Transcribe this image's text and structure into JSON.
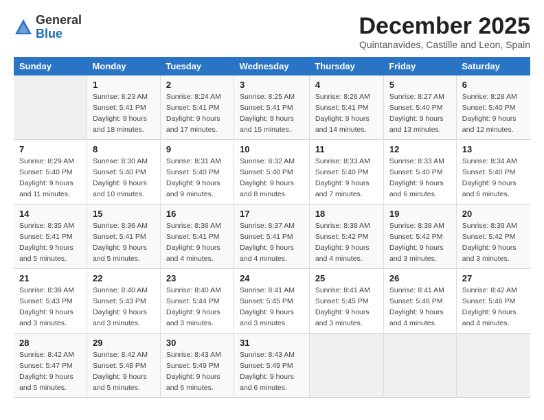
{
  "logo": {
    "general": "General",
    "blue": "Blue"
  },
  "title": "December 2025",
  "location": "Quintanavides, Castille and Leon, Spain",
  "weekdays": [
    "Sunday",
    "Monday",
    "Tuesday",
    "Wednesday",
    "Thursday",
    "Friday",
    "Saturday"
  ],
  "weeks": [
    [
      {
        "day": "",
        "info": ""
      },
      {
        "day": "1",
        "info": "Sunrise: 8:23 AM\nSunset: 5:41 PM\nDaylight: 9 hours\nand 18 minutes."
      },
      {
        "day": "2",
        "info": "Sunrise: 8:24 AM\nSunset: 5:41 PM\nDaylight: 9 hours\nand 17 minutes."
      },
      {
        "day": "3",
        "info": "Sunrise: 8:25 AM\nSunset: 5:41 PM\nDaylight: 9 hours\nand 15 minutes."
      },
      {
        "day": "4",
        "info": "Sunrise: 8:26 AM\nSunset: 5:41 PM\nDaylight: 9 hours\nand 14 minutes."
      },
      {
        "day": "5",
        "info": "Sunrise: 8:27 AM\nSunset: 5:40 PM\nDaylight: 9 hours\nand 13 minutes."
      },
      {
        "day": "6",
        "info": "Sunrise: 8:28 AM\nSunset: 5:40 PM\nDaylight: 9 hours\nand 12 minutes."
      }
    ],
    [
      {
        "day": "7",
        "info": "Sunrise: 8:29 AM\nSunset: 5:40 PM\nDaylight: 9 hours\nand 11 minutes."
      },
      {
        "day": "8",
        "info": "Sunrise: 8:30 AM\nSunset: 5:40 PM\nDaylight: 9 hours\nand 10 minutes."
      },
      {
        "day": "9",
        "info": "Sunrise: 8:31 AM\nSunset: 5:40 PM\nDaylight: 9 hours\nand 9 minutes."
      },
      {
        "day": "10",
        "info": "Sunrise: 8:32 AM\nSunset: 5:40 PM\nDaylight: 9 hours\nand 8 minutes."
      },
      {
        "day": "11",
        "info": "Sunrise: 8:33 AM\nSunset: 5:40 PM\nDaylight: 9 hours\nand 7 minutes."
      },
      {
        "day": "12",
        "info": "Sunrise: 8:33 AM\nSunset: 5:40 PM\nDaylight: 9 hours\nand 6 minutes."
      },
      {
        "day": "13",
        "info": "Sunrise: 8:34 AM\nSunset: 5:40 PM\nDaylight: 9 hours\nand 6 minutes."
      }
    ],
    [
      {
        "day": "14",
        "info": "Sunrise: 8:35 AM\nSunset: 5:41 PM\nDaylight: 9 hours\nand 5 minutes."
      },
      {
        "day": "15",
        "info": "Sunrise: 8:36 AM\nSunset: 5:41 PM\nDaylight: 9 hours\nand 5 minutes."
      },
      {
        "day": "16",
        "info": "Sunrise: 8:36 AM\nSunset: 5:41 PM\nDaylight: 9 hours\nand 4 minutes."
      },
      {
        "day": "17",
        "info": "Sunrise: 8:37 AM\nSunset: 5:41 PM\nDaylight: 9 hours\nand 4 minutes."
      },
      {
        "day": "18",
        "info": "Sunrise: 8:38 AM\nSunset: 5:42 PM\nDaylight: 9 hours\nand 4 minutes."
      },
      {
        "day": "19",
        "info": "Sunrise: 8:38 AM\nSunset: 5:42 PM\nDaylight: 9 hours\nand 3 minutes."
      },
      {
        "day": "20",
        "info": "Sunrise: 8:39 AM\nSunset: 5:42 PM\nDaylight: 9 hours\nand 3 minutes."
      }
    ],
    [
      {
        "day": "21",
        "info": "Sunrise: 8:39 AM\nSunset: 5:43 PM\nDaylight: 9 hours\nand 3 minutes."
      },
      {
        "day": "22",
        "info": "Sunrise: 8:40 AM\nSunset: 5:43 PM\nDaylight: 9 hours\nand 3 minutes."
      },
      {
        "day": "23",
        "info": "Sunrise: 8:40 AM\nSunset: 5:44 PM\nDaylight: 9 hours\nand 3 minutes."
      },
      {
        "day": "24",
        "info": "Sunrise: 8:41 AM\nSunset: 5:45 PM\nDaylight: 9 hours\nand 3 minutes."
      },
      {
        "day": "25",
        "info": "Sunrise: 8:41 AM\nSunset: 5:45 PM\nDaylight: 9 hours\nand 3 minutes."
      },
      {
        "day": "26",
        "info": "Sunrise: 8:41 AM\nSunset: 5:46 PM\nDaylight: 9 hours\nand 4 minutes."
      },
      {
        "day": "27",
        "info": "Sunrise: 8:42 AM\nSunset: 5:46 PM\nDaylight: 9 hours\nand 4 minutes."
      }
    ],
    [
      {
        "day": "28",
        "info": "Sunrise: 8:42 AM\nSunset: 5:47 PM\nDaylight: 9 hours\nand 5 minutes."
      },
      {
        "day": "29",
        "info": "Sunrise: 8:42 AM\nSunset: 5:48 PM\nDaylight: 9 hours\nand 5 minutes."
      },
      {
        "day": "30",
        "info": "Sunrise: 8:43 AM\nSunset: 5:49 PM\nDaylight: 9 hours\nand 6 minutes."
      },
      {
        "day": "31",
        "info": "Sunrise: 8:43 AM\nSunset: 5:49 PM\nDaylight: 9 hours\nand 6 minutes."
      },
      {
        "day": "",
        "info": ""
      },
      {
        "day": "",
        "info": ""
      },
      {
        "day": "",
        "info": ""
      }
    ]
  ]
}
